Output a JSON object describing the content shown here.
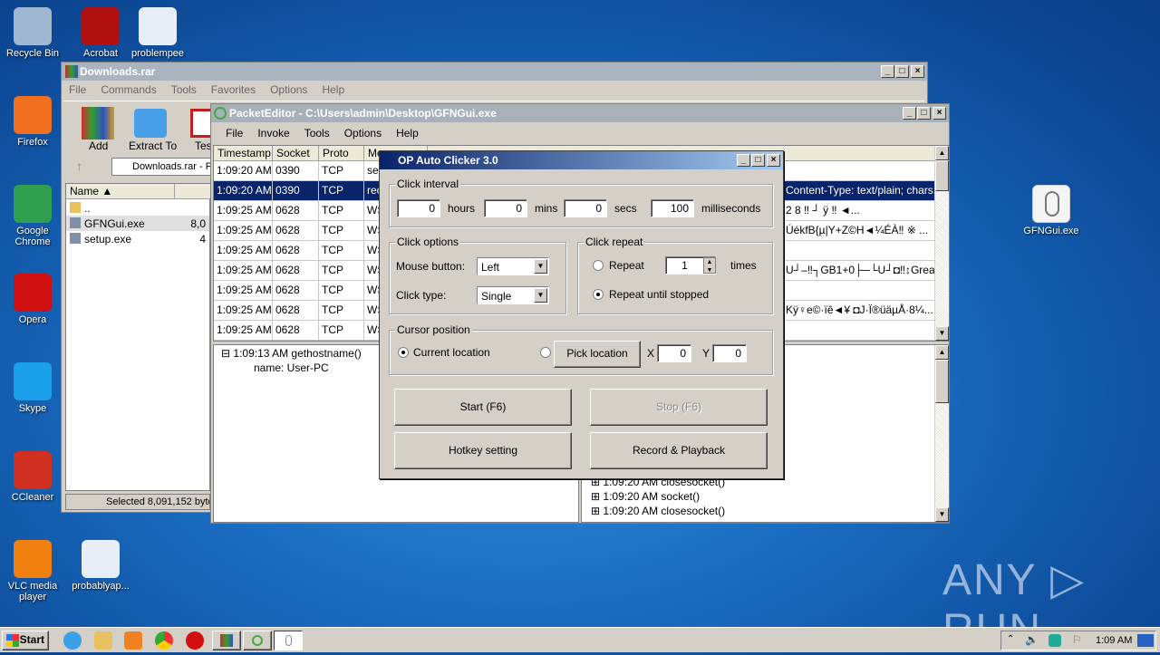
{
  "desktop": {
    "left_icons": [
      {
        "label": "Recycle Bin",
        "icon": "recycle-bin-icon",
        "color": "#9fb8d0"
      },
      {
        "label": "Acrobat",
        "icon": "acrobat-icon",
        "color": "#b01010"
      },
      {
        "label": "problempee",
        "icon": "word-doc-icon",
        "color": "#e8eef8"
      },
      {
        "label": "Firefox",
        "icon": "firefox-icon",
        "color": "#f07020"
      },
      {
        "label": "Google Chrome",
        "icon": "chrome-icon",
        "color": "#30a050"
      },
      {
        "label": "Opera",
        "icon": "opera-icon",
        "color": "#d01010"
      },
      {
        "label": "Skype",
        "icon": "skype-icon",
        "color": "#1aa0e8"
      },
      {
        "label": "CCleaner",
        "icon": "ccleaner-icon",
        "color": "#d03020"
      },
      {
        "label": "VLC media player",
        "icon": "vlc-icon",
        "color": "#f08010"
      },
      {
        "label": "probablyap...",
        "icon": "word-doc-icon",
        "color": "#e8eef8"
      }
    ],
    "right_icon": {
      "label": "GFNGui.exe",
      "icon": "mouse-icon"
    },
    "watermark": "ANY RUN"
  },
  "winrar": {
    "title": "Downloads.rar",
    "menu": [
      "File",
      "Commands",
      "Tools",
      "Favorites",
      "Options",
      "Help"
    ],
    "toolbar": [
      "Add",
      "Extract To",
      "Tes"
    ],
    "address": "Downloads.rar - P",
    "col_name": "Name",
    "files": [
      {
        "name": "..",
        "size": ""
      },
      {
        "name": "GFNGui.exe",
        "size": "8,0"
      },
      {
        "name": "setup.exe",
        "size": "4"
      }
    ],
    "status": "Selected 8,091,152 byte"
  },
  "packet": {
    "title": "PacketEditor - C:\\Users\\admin\\Desktop\\GFNGui.exe",
    "menu": [
      "File",
      "Invoke",
      "Tools",
      "Options",
      "Help"
    ],
    "columns": [
      "Timestamp",
      "Socket",
      "Proto",
      "Me"
    ],
    "rows": [
      {
        "ts": "1:09:20 AM",
        "sock": "0390",
        "proto": "TCP",
        "m": "ser",
        "data": ""
      },
      {
        "ts": "1:09:20 AM",
        "sock": "0390",
        "proto": "TCP",
        "m": "rec",
        "data": "Content-Type: text/plain; chars..."
      },
      {
        "ts": "1:09:25 AM",
        "sock": "0628",
        "proto": "TCP",
        "m": "WS",
        "data": "2 8 ‼ ┘        ÿ              ‼ ◄..."
      },
      {
        "ts": "1:09:25 AM",
        "sock": "0628",
        "proto": "TCP",
        "m": "WS",
        "data": "ÚékfB{µ|Y+Z©H◄¼ÉÀ‼   ※    ..."
      },
      {
        "ts": "1:09:25 AM",
        "sock": "0628",
        "proto": "TCP",
        "m": "WS",
        "data": ""
      },
      {
        "ts": "1:09:25 AM",
        "sock": "0628",
        "proto": "TCP",
        "m": "WS",
        "data": "U┘–‼┐GB1+0├─└U┘◘‼↕Greater ..."
      },
      {
        "ts": "1:09:25 AM",
        "sock": "0628",
        "proto": "TCP",
        "m": "WS",
        "data": ""
      },
      {
        "ts": "1:09:25 AM",
        "sock": "0628",
        "proto": "TCP",
        "m": "WS",
        "data": "Kÿ♀e©·ïê◄¥    ◘J·Ï®üäµÅ·8¼..."
      },
      {
        "ts": "1:09:25 AM",
        "sock": "0628",
        "proto": "TCP",
        "m": "WS",
        "data": ""
      }
    ],
    "tree_left": [
      {
        "text": "1:09:13 AM gethostname()",
        "child": "name: User-PC"
      }
    ],
    "tree_right": [
      "1:09:20 AM closesocket()",
      "1:09:20 AM socket()",
      "1:09:20 AM closesocket()"
    ]
  },
  "clicker": {
    "title": "OP Auto Clicker 3.0",
    "interval": {
      "label": "Click interval",
      "hours": "0",
      "hours_label": "hours",
      "mins": "0",
      "mins_label": "mins",
      "secs": "0",
      "secs_label": "secs",
      "ms": "100",
      "ms_label": "milliseconds"
    },
    "options": {
      "label": "Click options",
      "mouse_label": "Mouse button:",
      "mouse_value": "Left",
      "type_label": "Click type:",
      "type_value": "Single"
    },
    "repeat": {
      "label": "Click repeat",
      "repeat_label": "Repeat",
      "count": "1",
      "times_label": "times",
      "until_label": "Repeat until stopped",
      "selected": "until"
    },
    "cursor": {
      "label": "Cursor position",
      "current_label": "Current location",
      "pick_label": "Pick location",
      "x_label": "X",
      "x": "0",
      "y_label": "Y",
      "y": "0",
      "selected": "current"
    },
    "start": "Start (F6)",
    "stop": "Stop (F6)",
    "hotkey": "Hotkey setting",
    "record": "Record & Playback"
  },
  "taskbar": {
    "start": "Start",
    "clock": "1:09 AM"
  }
}
